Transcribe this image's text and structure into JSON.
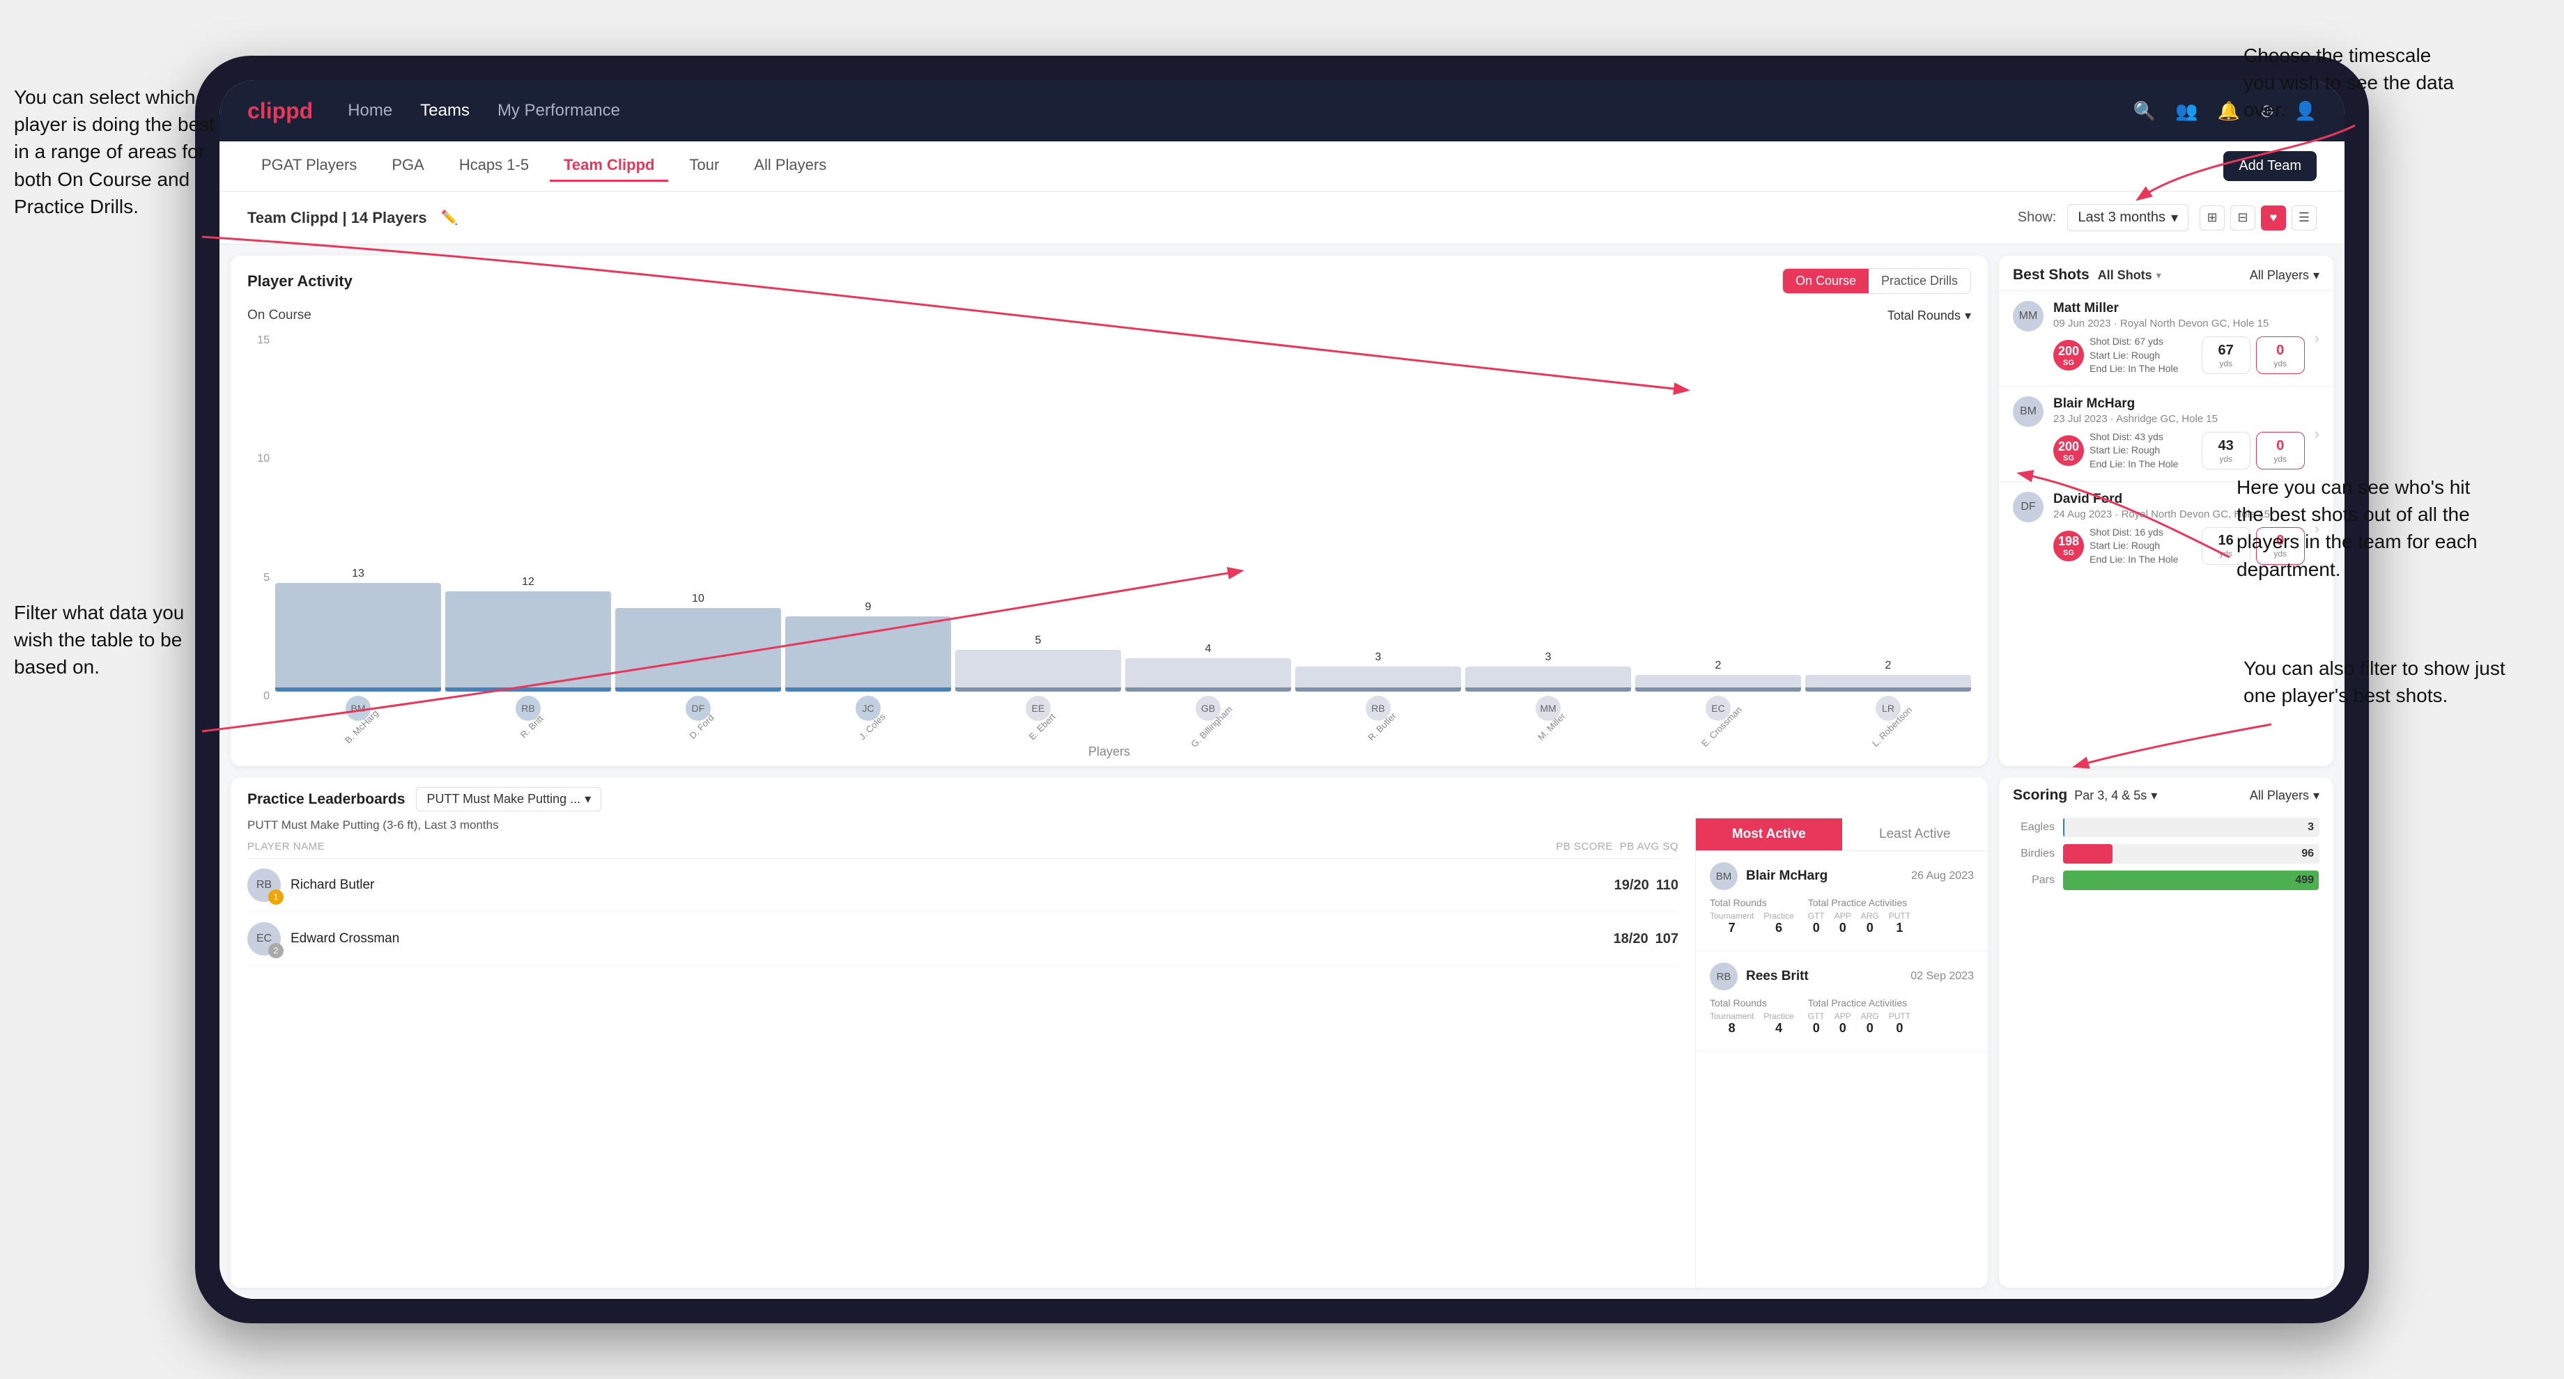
{
  "annotations": {
    "top_right": "Choose the timescale you\nwish to see the data over.",
    "top_left": "You can select which player is doing the best in a range of areas for both On Course and Practice Drills.",
    "middle_left": "Filter what data you wish the table to be based on.",
    "right_middle": "Here you can see who's hit the best shots out of all the players in the team for each department.",
    "right_bottom": "You can also filter to show just one player's best shots."
  },
  "nav": {
    "logo": "clippd",
    "links": [
      "Home",
      "Teams",
      "My Performance"
    ],
    "icons": [
      "search",
      "users",
      "bell",
      "add-circle",
      "user-circle"
    ]
  },
  "sub_nav": {
    "tabs": [
      "PGAT Players",
      "PGA",
      "Hcaps 1-5",
      "Team Clippd",
      "Tour",
      "All Players"
    ],
    "active_tab": "Team Clippd",
    "add_button": "Add Team"
  },
  "team_header": {
    "title": "Team Clippd | 14 Players",
    "show_label": "Show:",
    "show_value": "Last 3 months",
    "view_modes": [
      "grid-2",
      "grid-4",
      "heart",
      "list"
    ]
  },
  "player_activity": {
    "title": "Player Activity",
    "section_label": "On Course",
    "filter_label": "Total Rounds",
    "x_axis_label": "Players",
    "toggle_options": [
      "On Course",
      "Practice Drills"
    ],
    "active_toggle": "On Course",
    "bars": [
      {
        "name": "B. McHarg",
        "value": 13,
        "initials": "BM"
      },
      {
        "name": "R. Britt",
        "value": 12,
        "initials": "RB"
      },
      {
        "name": "D. Ford",
        "value": 10,
        "initials": "DF"
      },
      {
        "name": "J. Coles",
        "value": 9,
        "initials": "JC"
      },
      {
        "name": "E. Ebert",
        "value": 5,
        "initials": "EE"
      },
      {
        "name": "G. Billingham",
        "value": 4,
        "initials": "GB"
      },
      {
        "name": "R. Butler",
        "value": 3,
        "initials": "RB"
      },
      {
        "name": "M. Miller",
        "value": 3,
        "initials": "MM"
      },
      {
        "name": "E. Crossman",
        "value": 2,
        "initials": "EC"
      },
      {
        "name": "L. Robertson",
        "value": 2,
        "initials": "LR"
      }
    ],
    "y_axis": [
      "15",
      "10",
      "5",
      "0"
    ]
  },
  "best_shots": {
    "title": "Best Shots",
    "filter_tabs": [
      "All Shots",
      "Players"
    ],
    "active_tab": "All Shots",
    "players_filter": "All Players",
    "shots": [
      {
        "player": "Matt Miller",
        "meta": "09 Jun 2023 · Royal North Devon GC, Hole 15",
        "badge_num": "200",
        "badge_sub": "SG",
        "shot_desc": "Shot Dist: 67 yds\nStart Lie: Rough\nEnd Lie: In The Hole",
        "stat1_val": "67",
        "stat1_label": "yds",
        "stat2_val": "0",
        "stat2_label": "yds",
        "initials": "MM"
      },
      {
        "player": "Blair McHarg",
        "meta": "23 Jul 2023 · Ashridge GC, Hole 15",
        "badge_num": "200",
        "badge_sub": "SG",
        "shot_desc": "Shot Dist: 43 yds\nStart Lie: Rough\nEnd Lie: In The Hole",
        "stat1_val": "43",
        "stat1_label": "yds",
        "stat2_val": "0",
        "stat2_label": "yds",
        "initials": "BM"
      },
      {
        "player": "David Ford",
        "meta": "24 Aug 2023 · Royal North Devon GC, Hole 15",
        "badge_num": "198",
        "badge_sub": "SG",
        "shot_desc": "Shot Dist: 16 yds\nStart Lie: Rough\nEnd Lie: In The Hole",
        "stat1_val": "16",
        "stat1_label": "yds",
        "stat2_val": "0",
        "stat2_label": "yds",
        "initials": "DF"
      }
    ]
  },
  "practice_leaderboards": {
    "title": "Practice Leaderboards",
    "filter_label": "PUTT Must Make Putting ...",
    "subtitle": "PUTT Must Make Putting (3-6 ft), Last 3 months",
    "columns": [
      "PLAYER NAME",
      "PB SCORE",
      "PB AVG SQ"
    ],
    "players": [
      {
        "name": "Richard Butler",
        "initials": "RB",
        "pb_score": "19/20",
        "pb_avg": "110",
        "rank": 1
      },
      {
        "name": "Edward Crossman",
        "initials": "EC",
        "pb_score": "18/20",
        "pb_avg": "107",
        "rank": 2
      }
    ]
  },
  "activity": {
    "tabs": [
      "Most Active",
      "Least Active"
    ],
    "active_tab": "Most Active",
    "players": [
      {
        "name": "Blair McHarg",
        "date": "26 Aug 2023",
        "initials": "BM",
        "total_rounds_label": "Total Rounds",
        "tournament": "7",
        "practice": "6",
        "total_practice_label": "Total Practice Activities",
        "gtt": "0",
        "app": "0",
        "arg": "0",
        "putt": "1"
      },
      {
        "name": "Rees Britt",
        "date": "02 Sep 2023",
        "initials": "RB",
        "total_rounds_label": "Total Rounds",
        "tournament": "8",
        "practice": "4",
        "total_practice_label": "Total Practice Activities",
        "gtt": "0",
        "app": "0",
        "arg": "0",
        "putt": "0"
      }
    ]
  },
  "scoring": {
    "title": "Scoring",
    "filter_label": "Par 3, 4 & 5s",
    "players_filter": "All Players",
    "categories": [
      {
        "label": "Eagles",
        "value": 3,
        "max": 500,
        "color": "#2a7ae2"
      },
      {
        "label": "Birdies",
        "value": 96,
        "max": 500,
        "color": "#e8375a"
      },
      {
        "label": "Pars",
        "value": 499,
        "max": 500,
        "color": "#4caf50"
      }
    ]
  }
}
